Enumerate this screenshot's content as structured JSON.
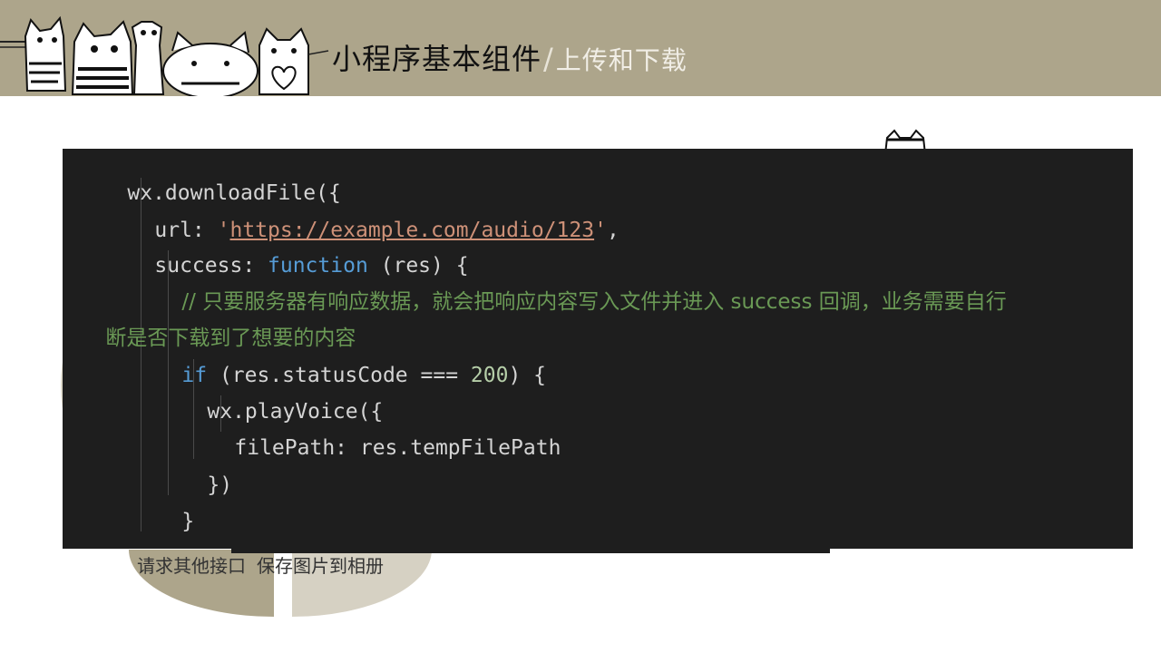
{
  "header": {
    "title_main": "小程序基本组件",
    "title_sep": "/",
    "title_sub": "上传和下载"
  },
  "code": {
    "l1": "wx.downloadFile({",
    "l2_key": "url: ",
    "l2_q1": "'",
    "l2_url": "https://example.com/audio/123",
    "l2_q2": "'",
    "l2_end": ",",
    "l3_key": "success: ",
    "l3_fn": "function",
    "l3_end": " (res) {",
    "l4_comment": "// 只要服务器有响应数据，就会把响应内容写入文件并进入 success 回调，业务需要自行",
    "l5_comment": "断是否下载到了想要的内容",
    "l6_if": "if",
    "l6_mid": " (res.statusCode === ",
    "l6_num": "200",
    "l6_end": ") {",
    "l7": "wx.playVoice({",
    "l8": "filePath: res.tempFilePath",
    "l9": "})",
    "l10": "}",
    "l11": "}"
  },
  "captions": {
    "item1": "请求其他接口",
    "item2": "保存图片到相册"
  },
  "colors": {
    "banner": "#ada58b",
    "code_bg": "#1e1e1e",
    "string": "#ce9178",
    "keyword": "#569cd6",
    "comment": "#6a9955",
    "number": "#b5cea8"
  }
}
